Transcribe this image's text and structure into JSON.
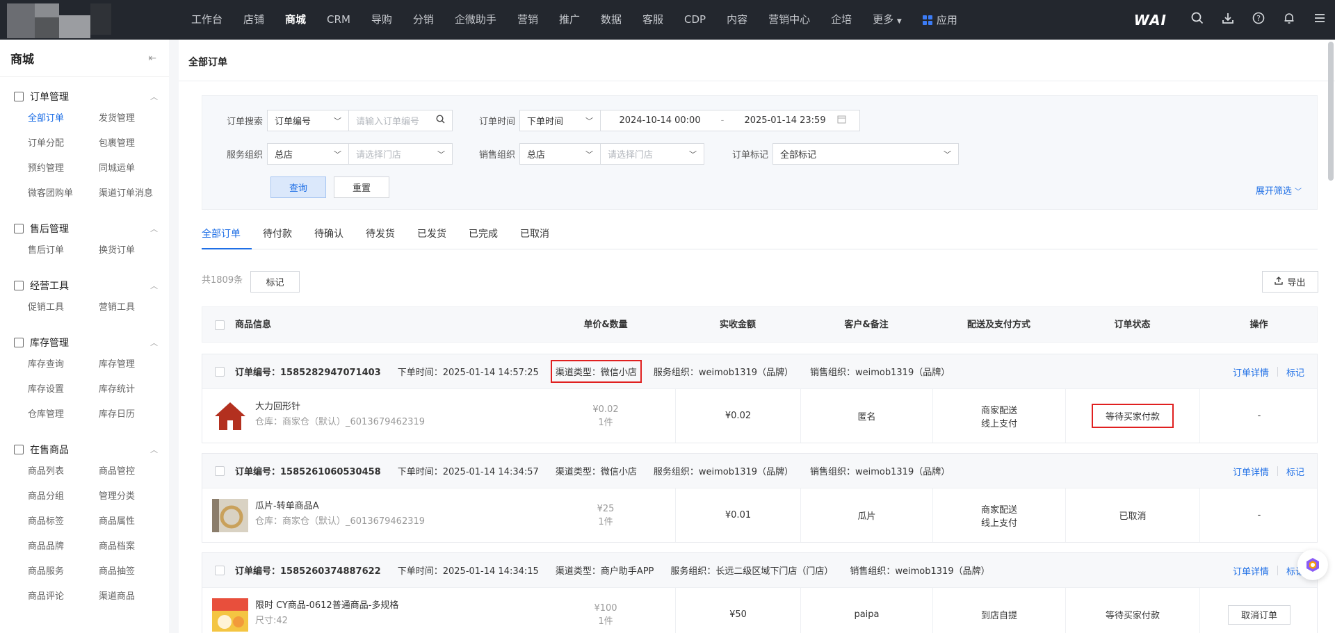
{
  "nav": {
    "items": [
      "工作台",
      "店铺",
      "商城",
      "CRM",
      "导购",
      "分销",
      "企微助手",
      "营销",
      "推广",
      "数据",
      "客服",
      "CDP",
      "内容",
      "营销中心",
      "企培",
      "更多"
    ],
    "apps_label": "应用",
    "brand": "WAI"
  },
  "sidebar": {
    "title": "商城",
    "groups": [
      {
        "title": "订单管理",
        "items": [
          "全部订单",
          "发货管理",
          "订单分配",
          "包裹管理",
          "预约管理",
          "同城运单",
          "微客团购单",
          "渠道订单消息"
        ]
      },
      {
        "title": "售后管理",
        "items": [
          "售后订单",
          "换货订单"
        ]
      },
      {
        "title": "经营工具",
        "items": [
          "促销工具",
          "营销工具"
        ]
      },
      {
        "title": "库存管理",
        "items": [
          "库存查询",
          "库存管理",
          "库存设置",
          "库存统计",
          "仓库管理",
          "库存日历"
        ]
      },
      {
        "title": "在售商品",
        "items": [
          "商品列表",
          "商品管控",
          "商品分组",
          "管理分类",
          "商品标签",
          "商品属性",
          "商品品牌",
          "商品档案",
          "商品服务",
          "商品抽签",
          "商品评论",
          "渠道商品"
        ]
      }
    ]
  },
  "page": {
    "title": "全部订单"
  },
  "filter": {
    "search_label": "订单搜索",
    "search_type": "订单编号",
    "search_placeholder": "请输入订单编号",
    "time_label": "订单时间",
    "time_type": "下单时间",
    "time_start": "2024-10-14 00:00",
    "time_sep": "-",
    "time_end": "2025-01-14 23:59",
    "service_label": "服务组织",
    "service_value": "总店",
    "service_store_placeholder": "请选择门店",
    "sales_label": "销售组织",
    "sales_value": "总店",
    "sales_store_placeholder": "请选择门店",
    "mark_label": "订单标记",
    "mark_value": "全部标记",
    "query_btn": "查询",
    "reset_btn": "重置",
    "expand": "展开筛选"
  },
  "tabs": [
    "全部订单",
    "待付款",
    "待确认",
    "待发货",
    "已发货",
    "已完成",
    "已取消"
  ],
  "toolbar": {
    "total": "共1809条",
    "mark_btn": "标记",
    "export_btn": "导出"
  },
  "table": {
    "headers": [
      "商品信息",
      "单价&数量",
      "实收金额",
      "客户&备注",
      "配送及支付方式",
      "订单状态",
      "操作"
    ]
  },
  "orders": [
    {
      "no": "订单编号：1585282947071403",
      "time": "下单时间：2025-01-14 14:57:25",
      "channel": "渠道类型：微信小店",
      "service": "服务组织：weimob1319（品牌）",
      "sales": "销售组织：weimob1319（品牌）",
      "detail": "订单详情",
      "mark": "标记",
      "product": "大力回形针",
      "warehouse": "仓库：商家仓（默认）_6013679462319",
      "price": "¥0.02",
      "qty": "1件",
      "paid": "¥0.02",
      "customer": "匿名",
      "delivery": "商家配送",
      "payment": "线上支付",
      "status": "等待买家付款",
      "action": "-"
    },
    {
      "no": "订单编号：1585261060530458",
      "time": "下单时间：2025-01-14 14:34:57",
      "channel": "渠道类型：微信小店",
      "service": "服务组织：weimob1319（品牌）",
      "sales": "销售组织：weimob1319（品牌）",
      "detail": "订单详情",
      "mark": "标记",
      "product": "瓜片-转单商品A",
      "warehouse": "仓库：商家仓（默认）_6013679462319",
      "price": "¥25",
      "qty": "1件",
      "paid": "¥0.01",
      "customer": "瓜片",
      "delivery": "商家配送",
      "payment": "线上支付",
      "status": "已取消",
      "action": "-"
    },
    {
      "no": "订单编号：1585260374887622",
      "time": "下单时间：2025-01-14 14:34:15",
      "channel": "渠道类型：商户助手APP",
      "service": "服务组织：长远二级区域下门店（门店）",
      "sales": "销售组织：weimob1319（品牌）",
      "detail": "订单详情",
      "mark": "标记",
      "product": "限时   CY商品-0612普通商品-多规格",
      "warehouse": "尺寸:42",
      "price": "¥100",
      "qty": "1件",
      "paid": "¥50",
      "customer": "paipa",
      "delivery": "到店自提",
      "payment": "",
      "status": "等待买家付款",
      "action": "取消订单"
    }
  ],
  "colors": {
    "accent": "#1f6fe6",
    "highlight": "#e02020",
    "topbar": "#23272e"
  }
}
